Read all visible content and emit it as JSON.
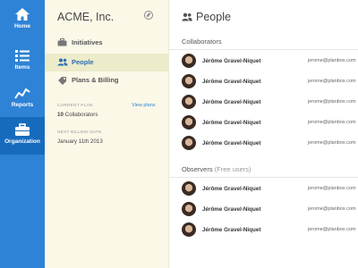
{
  "nav": {
    "items": [
      {
        "label": "Home",
        "icon": "home-icon",
        "active": false
      },
      {
        "label": "Items",
        "icon": "list-icon",
        "active": false
      },
      {
        "label": "Reports",
        "icon": "chart-icon",
        "active": false
      },
      {
        "label": "Organization",
        "icon": "briefcase-icon",
        "active": true
      }
    ]
  },
  "org": {
    "name": "ACME, Inc.",
    "menu": [
      {
        "label": "Initiatives",
        "icon": "briefcase-icon",
        "active": false
      },
      {
        "label": "People",
        "icon": "people-icon",
        "active": true
      },
      {
        "label": "Plans & Billing",
        "icon": "tag-icon",
        "active": false
      }
    ],
    "plan": {
      "current_label": "Current Plan",
      "count": "10",
      "count_suffix": "Collaborators",
      "view_link": "View plans",
      "next_billing_label": "Next Billing Date",
      "next_billing_value": "January 11th 2013"
    }
  },
  "main": {
    "title": "People",
    "collaborators_heading": "Collaborators",
    "observers_heading": "Observers",
    "observers_note": "(Free users)",
    "collaborators": [
      {
        "name": "Jérôme Gravel-Niquet",
        "email": "jerome@planbox.com"
      },
      {
        "name": "Jérôme Gravel-Niquet",
        "email": "jerome@planbox.com"
      },
      {
        "name": "Jérôme Gravel-Niquet",
        "email": "jerome@planbox.com"
      },
      {
        "name": "Jérôme Gravel-Niquet",
        "email": "jerome@planbox.com"
      },
      {
        "name": "Jérôme Gravel-Niquet",
        "email": "jerome@planbox.com"
      }
    ],
    "observers": [
      {
        "name": "Jérôme Gravel-Niquet",
        "email": "jerome@planbox.com"
      },
      {
        "name": "Jérôme Gravel-Niquet",
        "email": "jerome@planbox.com"
      },
      {
        "name": "Jérôme Gravel-Niquet",
        "email": "jerome@planbox.com"
      }
    ]
  },
  "colors": {
    "rail": "#2e83d6",
    "rail_active": "#176bbd",
    "panel": "#fbf8e8",
    "panel_active": "#ecebca",
    "link": "#2e83d6"
  }
}
